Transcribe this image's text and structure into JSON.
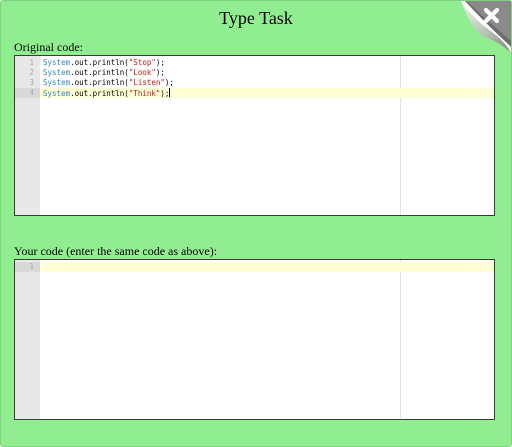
{
  "dialog": {
    "title": "Type Task",
    "close_icon": "close-icon"
  },
  "original": {
    "label": "Original code:",
    "lines": [
      {
        "num": "1",
        "cls": "System",
        "mid": ".out.println(",
        "str": "\"Stop\"",
        "end": ");"
      },
      {
        "num": "2",
        "cls": "System",
        "mid": ".out.println(",
        "str": "\"Look\"",
        "end": ");"
      },
      {
        "num": "3",
        "cls": "System",
        "mid": ".out.println(",
        "str": "\"Listen\"",
        "end": ");"
      },
      {
        "num": "4",
        "cls": "System",
        "mid": ".out.println(",
        "str": "\"Think\"",
        "end": ");"
      }
    ]
  },
  "yours": {
    "label": "Your code (enter the same code as above):",
    "lines": [
      {
        "num": "1"
      }
    ]
  },
  "colors": {
    "background": "#90ee90",
    "keyword": "#2f86c9",
    "string": "#c41a16",
    "active_line": "#ffffd6"
  }
}
